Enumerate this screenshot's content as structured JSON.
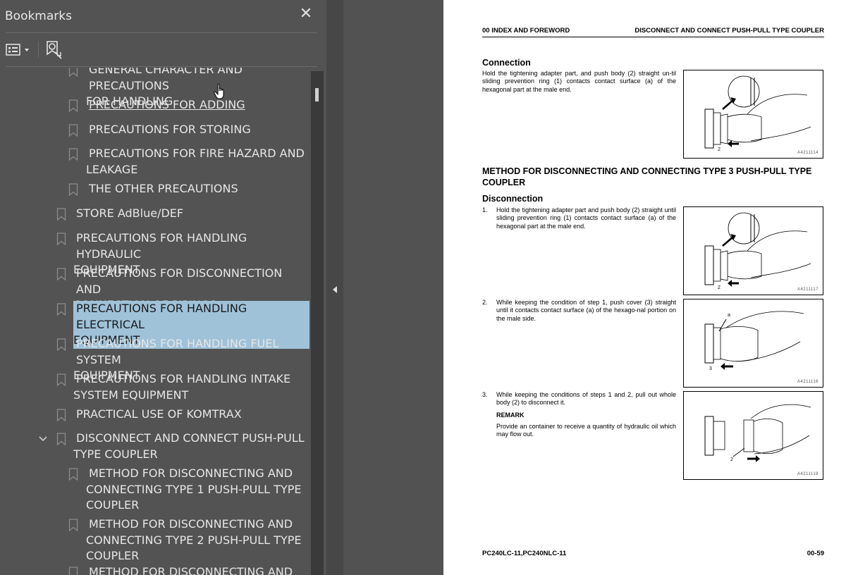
{
  "panel": {
    "title": "Bookmarks",
    "close_label": "✕",
    "options_icon": "bookmark-options-icon",
    "find_icon": "find-bookmark-icon"
  },
  "bookmarks": [
    {
      "lines": [
        "GENERAL CHARACTER AND PRECAUTIONS",
        "FOR HANDLING"
      ],
      "indent": 3,
      "partial": true
    },
    {
      "lines": [
        "PRECAUTIONS FOR ADDING"
      ],
      "indent": 3,
      "underline": true
    },
    {
      "lines": [
        "PRECAUTIONS FOR STORING"
      ],
      "indent": 3
    },
    {
      "lines": [
        "PRECAUTIONS FOR FIRE HAZARD AND",
        "LEAKAGE"
      ],
      "indent": 3
    },
    {
      "lines": [
        "THE OTHER PRECAUTIONS"
      ],
      "indent": 3
    },
    {
      "lines": [
        "STORE AdBlue/DEF"
      ],
      "indent": 2
    },
    {
      "lines": [
        "PRECAUTIONS FOR HANDLING HYDRAULIC",
        "EQUIPMENT"
      ],
      "indent": 2
    },
    {
      "lines": [
        "PRECAUTIONS FOR DISCONNECTION AND",
        "CONNECTION OF PIPINGS"
      ],
      "indent": 2
    },
    {
      "lines": [
        "PRECAUTIONS FOR HANDLING ELECTRICAL",
        "EQUIPMENT"
      ],
      "indent": 2,
      "selected": true
    },
    {
      "lines": [
        "PRECAUTIONS FOR HANDLING FUEL SYSTEM",
        "EQUIPMENT"
      ],
      "indent": 2
    },
    {
      "lines": [
        "PRECAUTIONS FOR HANDLING INTAKE",
        "SYSTEM EQUIPMENT"
      ],
      "indent": 2
    },
    {
      "lines": [
        "PRACTICAL USE OF KOMTRAX"
      ],
      "indent": 2
    },
    {
      "lines": [
        "DISCONNECT AND CONNECT PUSH-PULL",
        "TYPE COUPLER"
      ],
      "indent": 2,
      "expanded": true
    },
    {
      "lines": [
        "METHOD FOR DISCONNECTING AND",
        "CONNECTING TYPE 1 PUSH-PULL TYPE",
        "COUPLER"
      ],
      "indent": 3
    },
    {
      "lines": [
        "METHOD FOR DISCONNECTING AND",
        "CONNECTING TYPE 2 PUSH-PULL TYPE",
        "COUPLER"
      ],
      "indent": 3
    },
    {
      "lines": [
        "METHOD FOR DISCONNECTING AND"
      ],
      "indent": 3,
      "partial": true
    }
  ],
  "colors": {
    "panel_bg": "#535353",
    "selected_bg": "#9fc2d9",
    "page_bg": "#ffffff",
    "viewer_bg": "#525252"
  },
  "page": {
    "header_left": "00 INDEX AND FOREWORD",
    "header_right": "DISCONNECT AND CONNECT PUSH-PULL TYPE COUPLER",
    "connection_heading": "Connection",
    "connection_text": "Hold the tightening adapter part, and push body (2) straight un-til sliding prevention ring (1) contacts contact surface (a) of the hexagonal part at the male end.",
    "fig1_code": "A4211114",
    "method3_heading": "METHOD FOR DISCONNECTING AND CONNECTING TYPE 3 PUSH-PULL TYPE COUPLER",
    "disconnection_heading": "Disconnection",
    "step1_num": "1.",
    "step1_text": "Hold the tightening adapter part and push body (2) straight until sliding prevention ring (1) contacts contact surface (a) of the hexagonal part at the male end.",
    "fig2_code": "A4211117",
    "step2_num": "2.",
    "step2_text": "While keeping the condition of step 1, push cover (3) straight until it contacts contact surface (a) of the hexago-nal portion on the male side.",
    "fig3_code": "A4211116",
    "step3_num": "3.",
    "step3_text": "While keeping the conditions of steps 1 and 2, pull out whole body (2) to disconnect it.",
    "remark_label": "REMARK",
    "remark_text": "Provide an container to receive a quantity of hydraulic oil which may flow out.",
    "fig4_code": "A4211118",
    "footer_left": "PC240LC-11,PC240NLC-11",
    "footer_right": "00-59"
  }
}
